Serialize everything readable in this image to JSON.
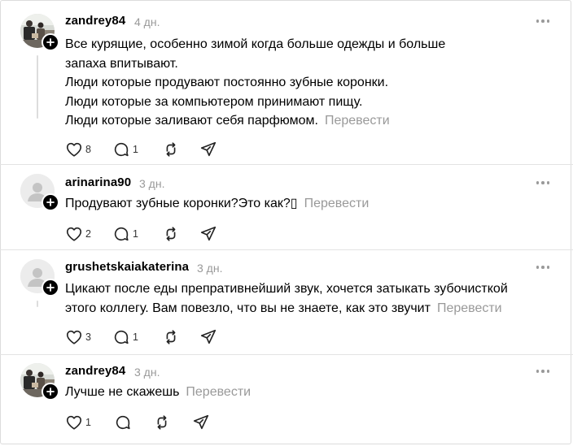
{
  "posts": [
    {
      "username": "zandrey84",
      "time": "4 дн.",
      "avatar": "photo",
      "lines": [
        "Все курящие, особенно зимой когда больше одежды и больше",
        "запаха впитывают.",
        "Люди которые продувают постоянно зубные коронки.",
        "Люди которые за компьютером принимают пищу.",
        "Люди которые заливают себя парфюмом."
      ],
      "translate": "Перевести",
      "likes": "8",
      "replies": "1",
      "reposts": "",
      "shares": ""
    },
    {
      "username": "arinarina90",
      "time": "3 дн.",
      "avatar": "default",
      "lines": [
        "Продувают зубные коронки?Это как?▯"
      ],
      "translate": "Перевести",
      "likes": "2",
      "replies": "1",
      "reposts": "",
      "shares": ""
    },
    {
      "username": "grushetskaiakaterina",
      "time": "3 дн.",
      "avatar": "default",
      "lines": [
        "Цикают после еды препративнейший звук, хочется затыкать зубочисткой",
        "этого коллегу. Вам повезло, что вы не знаете, как это звучит"
      ],
      "translate": "Перевести",
      "likes": "3",
      "replies": "1",
      "reposts": "",
      "shares": ""
    },
    {
      "username": "zandrey84",
      "time": "3 дн.",
      "avatar": "photo",
      "lines": [
        "Лучше не скажешь"
      ],
      "translate": "Перевести",
      "likes": "1",
      "replies": "",
      "reposts": "",
      "shares": ""
    }
  ]
}
